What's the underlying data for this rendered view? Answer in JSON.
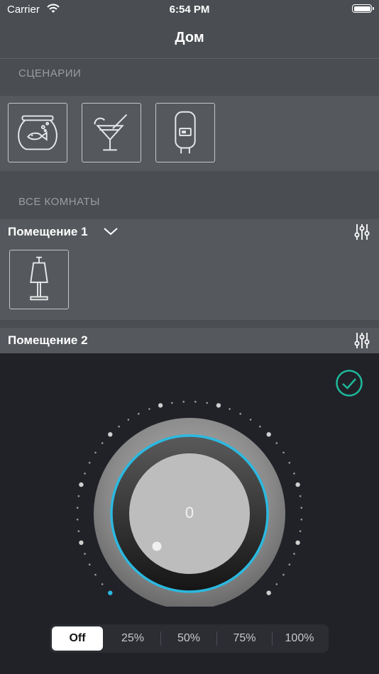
{
  "status_bar": {
    "carrier": "Carrier",
    "time": "6:54 PM"
  },
  "nav": {
    "title": "Дом"
  },
  "scenes": {
    "label": "СЦЕНАРИИ",
    "tiles": [
      {
        "icon": "fishbowl-icon"
      },
      {
        "icon": "cocktail-icon"
      },
      {
        "icon": "water-heater-icon"
      }
    ]
  },
  "rooms": {
    "label": "ВСЕ КОМНАТЫ",
    "items": [
      {
        "name": "Помещение 1",
        "expanded": true,
        "devices": [
          {
            "icon": "table-lamp-icon"
          }
        ]
      },
      {
        "name": "Помещение 2",
        "expanded": false
      }
    ]
  },
  "dimmer": {
    "value": "0",
    "accent_color": "#2bb9e0",
    "confirm_color": "#1fb89a",
    "options": [
      "Off",
      "25%",
      "50%",
      "75%",
      "100%"
    ],
    "selected": "Off"
  }
}
